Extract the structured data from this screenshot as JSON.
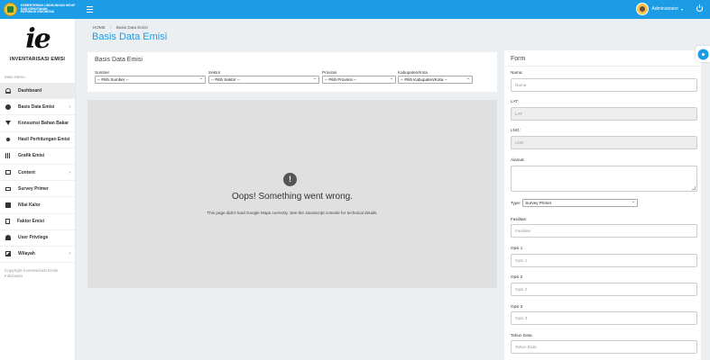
{
  "header": {
    "org_lines": [
      "KEMENTERIAN LINGKUNGAN HIDUP",
      "DAN KEHUTANAN",
      "REPUBLIK INDONESIA"
    ],
    "user_name": "Administrator",
    "accent": "#1b9ce5"
  },
  "sidebar": {
    "brand_logo": "ie",
    "brand_name": "INVENTARISASI EMISI",
    "menu_label": "Main Menu",
    "items": [
      {
        "label": "Dashboard",
        "icon": "dashboard-icon",
        "active": true
      },
      {
        "label": "Basis Data Emisi",
        "icon": "info-icon",
        "submenu": true
      },
      {
        "label": "Konsumsi Bahan Bakar",
        "icon": "filter-icon"
      },
      {
        "label": "Hasil Perhitungan Emisi",
        "icon": "gear-icon"
      },
      {
        "label": "Grafik Emisi",
        "icon": "bar-chart-icon"
      },
      {
        "label": "Content",
        "icon": "monitor-icon",
        "submenu": true
      },
      {
        "label": "Survey Primer",
        "icon": "card-icon"
      },
      {
        "label": "Nilai Kalor",
        "icon": "square-icon"
      },
      {
        "label": "Faktor Emisi",
        "icon": "document-icon"
      },
      {
        "label": "User Privilege",
        "icon": "user-icon"
      },
      {
        "label": "Wilayah",
        "icon": "image-icon",
        "submenu": true
      }
    ],
    "copyright": "Copyright Inventarisasi Emisi Indonesia"
  },
  "breadcrumb": {
    "home": "HOME",
    "current": "Basis Data Emisi"
  },
  "page_title": "Basis Data Emisi",
  "basis_card": {
    "title": "Basis Data Emisi",
    "filters": [
      {
        "label": "Sumber",
        "value": "-- Pilih Sumber --"
      },
      {
        "label": "Sektor",
        "value": "-- Pilih Sektor --"
      },
      {
        "label": "Provinsi",
        "value": "-- Pilih Provinsi --"
      },
      {
        "label": "Kabupaten/Kota",
        "value": "-- Pilih Kabupaten/Kota --"
      }
    ]
  },
  "map_error": {
    "icon": "!",
    "title": "Oops! Something went wrong.",
    "message": "This page didn't load Google Maps correctly. See the JavaScript console for technical details."
  },
  "form": {
    "title": "Form",
    "nama_label": "Nama:",
    "nama_placeholder": "Nama",
    "lat_label": "LAT:",
    "lat_placeholder": "LAT",
    "lng_label": "LNG:",
    "lng_placeholder": "LNG",
    "alamat_label": "Alamat:",
    "type_label": "Type:",
    "type_value": "Survey Primer",
    "fasilitas_label": "Fasilitas:",
    "fasilitas_placeholder": "Fasilitas",
    "opsi1_label": "Opsi 1",
    "opsi1_placeholder": "Opsi 1",
    "opsi2_label": "Opsi 2",
    "opsi2_placeholder": "Opsi 2",
    "opsi3_label": "Opsi 3",
    "opsi3_placeholder": "Opsi 3",
    "tahun_label": "Tahun Data",
    "tahun_placeholder": "Tahun Data"
  }
}
